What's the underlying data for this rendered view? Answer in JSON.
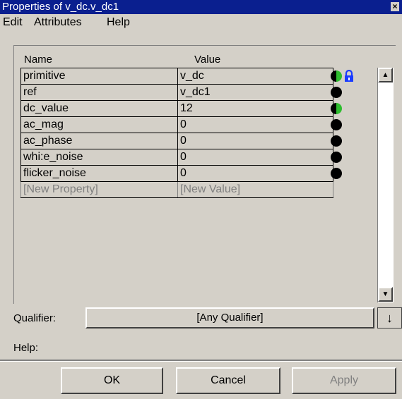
{
  "window": {
    "title": "Properties of v_dc.v_dc1",
    "close_label": "×"
  },
  "menu": [
    "Edit",
    "Attributes",
    "Help"
  ],
  "table": {
    "headers": {
      "name": "Name",
      "value": "Value"
    },
    "rows": [
      {
        "name": "primitive",
        "value": "v_dc",
        "status": "half-green",
        "locked": true
      },
      {
        "name": "ref",
        "value": "v_dc1",
        "status": "black",
        "locked": false
      },
      {
        "name": "dc_value",
        "value": "12",
        "status": "half-green",
        "locked": false
      },
      {
        "name": "ac_mag",
        "value": "0",
        "status": "black",
        "locked": false
      },
      {
        "name": "ac_phase",
        "value": "0",
        "status": "black",
        "locked": false
      },
      {
        "name": "whi:e_noise",
        "value": "0",
        "status": "black",
        "locked": false
      },
      {
        "name": "flicker_noise",
        "value": "0",
        "status": "black",
        "locked": false
      }
    ],
    "new_row": {
      "name": "[New Property]",
      "value": "[New Value]"
    }
  },
  "qualifier": {
    "label": "Qualifier:",
    "value": "[Any Qualifier]",
    "button": "↓"
  },
  "help_label": "Help:",
  "buttons": {
    "ok": "OK",
    "cancel": "Cancel",
    "apply": "Apply"
  },
  "colors": {
    "titlebar": "#0a1f8f",
    "face": "#d4d0c8",
    "status_green": "#2ebd2e",
    "lock_blue": "#1a3cff"
  }
}
